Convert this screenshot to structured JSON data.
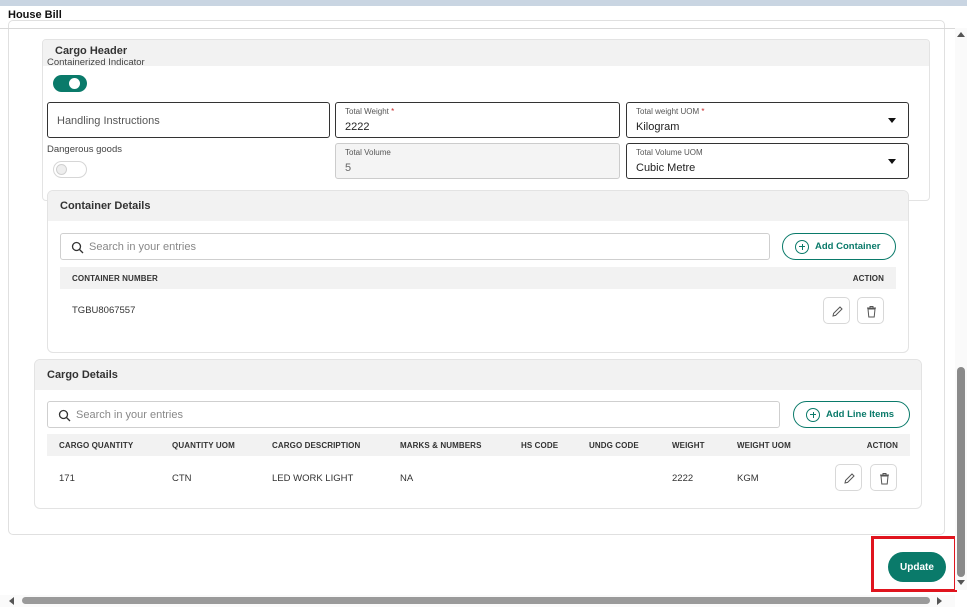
{
  "modal": {
    "title": "House Bill"
  },
  "cargo_header": {
    "title": "Cargo Header",
    "containerized_label": "Containerized Indicator",
    "containerized_on": true,
    "handling_placeholder": "Handling Instructions",
    "total_weight_label": "Total Weight",
    "total_weight_value": "2222",
    "total_weight_uom_label": "Total weight UOM",
    "total_weight_uom_value": "Kilogram",
    "dangerous_label": "Dangerous goods",
    "dangerous_on": false,
    "total_volume_label": "Total Volume",
    "total_volume_value": "5",
    "total_volume_uom_label": "Total Volume UOM",
    "total_volume_uom_value": "Cubic Metre",
    "required_mark": "*"
  },
  "container_details": {
    "title": "Container Details",
    "search_placeholder": "Search in your entries",
    "add_label": "Add Container",
    "columns": {
      "number": "CONTAINER NUMBER",
      "action": "ACTION"
    },
    "rows": [
      {
        "number": "TGBU8067557"
      }
    ]
  },
  "cargo_details": {
    "title": "Cargo Details",
    "search_placeholder": "Search in your entries",
    "add_label": "Add Line Items",
    "columns": {
      "quantity": "CARGO QUANTITY",
      "uom": "QUANTITY UOM",
      "description": "CARGO DESCRIPTION",
      "marks": "MARKS & NUMBERS",
      "hs": "HS CODE",
      "undg": "UNDG CODE",
      "weight": "WEIGHT",
      "weight_uom": "WEIGHT UOM",
      "action": "ACTION"
    },
    "rows": [
      {
        "quantity": "171",
        "uom": "CTN",
        "description": "LED WORK LIGHT",
        "marks": "NA",
        "hs": "",
        "undg": "",
        "weight": "2222",
        "weight_uom": "KGM"
      }
    ]
  },
  "footer": {
    "update_label": "Update"
  },
  "colors": {
    "accent": "#0a7a6a",
    "highlight": "#e0141e"
  },
  "icons": [
    "search-icon",
    "plus-circle-icon",
    "edit-pencil-icon",
    "trash-icon",
    "dropdown-caret-icon"
  ]
}
